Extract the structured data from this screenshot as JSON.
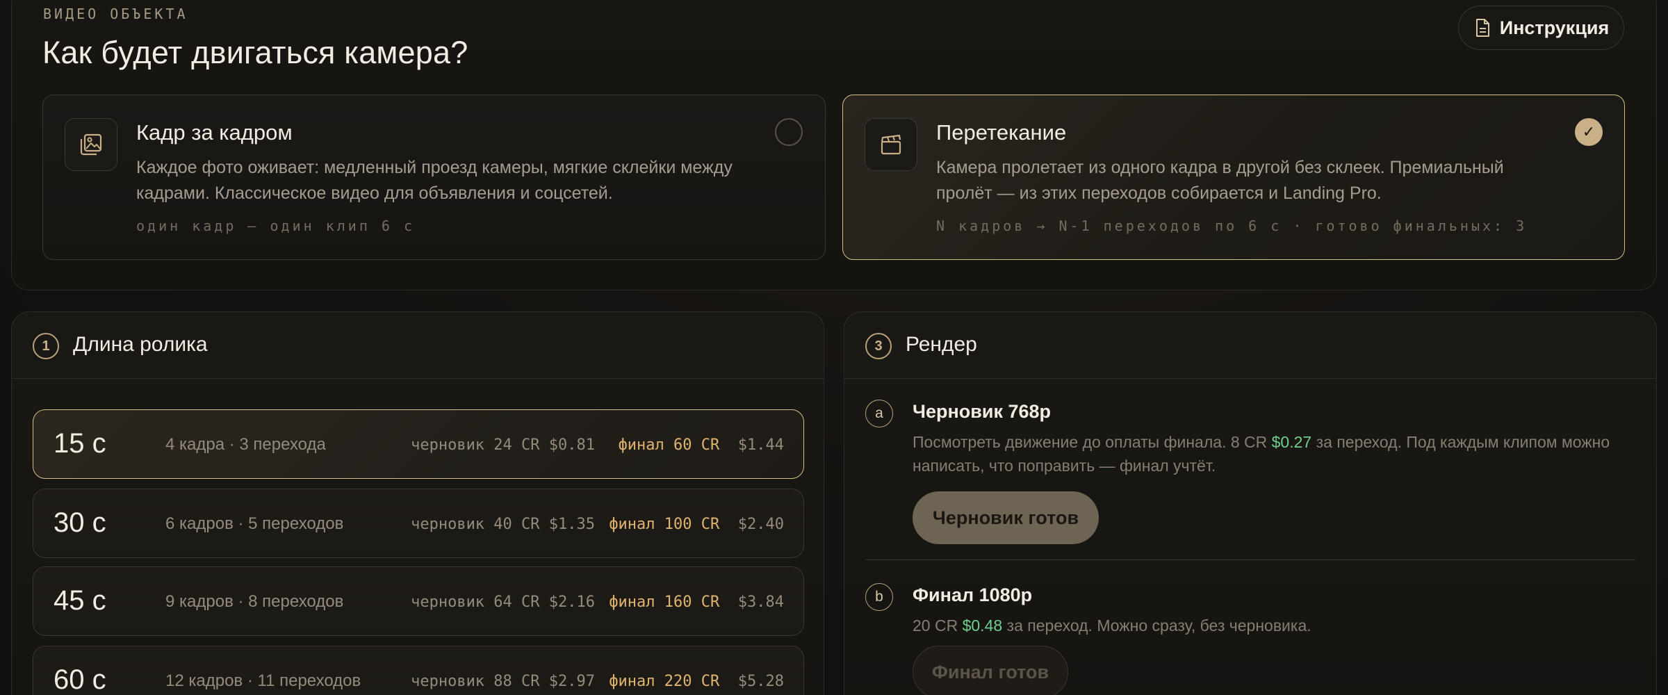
{
  "header": {
    "eyebrow": "ВИДЕО ОБЪЕКТА",
    "title": "Как будет двигаться камера?",
    "instruction_button": "Инструкция"
  },
  "modes": [
    {
      "title": "Кадр за кадром",
      "description": "Каждое фото оживает: медленный проезд камеры, мягкие склейки между кадрами. Классическое видео для объявления и соцсетей.",
      "meta": "один кадр — один клип 6 с",
      "icon": "image-icon",
      "selected": false
    },
    {
      "title": "Перетекание",
      "description": "Камера пролетает из одного кадра в другой без склеек. Премиальный пролёт — из этих переходов собирается и Landing Pro.",
      "meta": "N кадров → N-1 переходов по 6 с · готово финальных: 3",
      "icon": "clapperboard-icon",
      "selected": true,
      "check": "✓"
    }
  ],
  "duration_panel": {
    "step": "1",
    "title": "Длина ролика",
    "rows": [
      {
        "seconds": "15 с",
        "frames": "4 кадра · 3 перехода",
        "draft": "черновик 24 CR $0.81",
        "final_label": "финал 60 CR",
        "final_usd": "$1.44",
        "selected": true
      },
      {
        "seconds": "30 с",
        "frames": "6 кадров · 5 переходов",
        "draft": "черновик 40 CR $1.35",
        "final_label": "финал 100 CR",
        "final_usd": "$2.40",
        "selected": false
      },
      {
        "seconds": "45 с",
        "frames": "9 кадров · 8 переходов",
        "draft": "черновик 64 CR $2.16",
        "final_label": "финал 160 CR",
        "final_usd": "$3.84",
        "selected": false
      },
      {
        "seconds": "60 с",
        "frames": "12 кадров · 11 переходов",
        "draft": "черновик 88 CR $2.97",
        "final_label": "финал 220 CR",
        "final_usd": "$5.28",
        "selected": false
      }
    ]
  },
  "render_panel": {
    "step": "3",
    "title": "Рендер",
    "draft": {
      "letter": "a",
      "title": "Черновик 768p",
      "desc_before": "Посмотреть движение до оплаты финала. 8 CR ",
      "desc_price": "$0.27",
      "desc_after": " за переход. Под каждым клипом можно написать, что поправить — финал учтёт.",
      "button": "Черновик готов"
    },
    "final": {
      "letter": "b",
      "desc_before": "20 CR ",
      "desc_price": "$0.48",
      "desc_after": " за переход. Можно сразу, без черновика.",
      "title": "Финал 1080p",
      "button": "Финал готов"
    }
  },
  "colors": {
    "accent": "#d8bf8a",
    "final_price": "#e0b46e",
    "usd_green": "#6fcf8e",
    "background": "#141210"
  }
}
